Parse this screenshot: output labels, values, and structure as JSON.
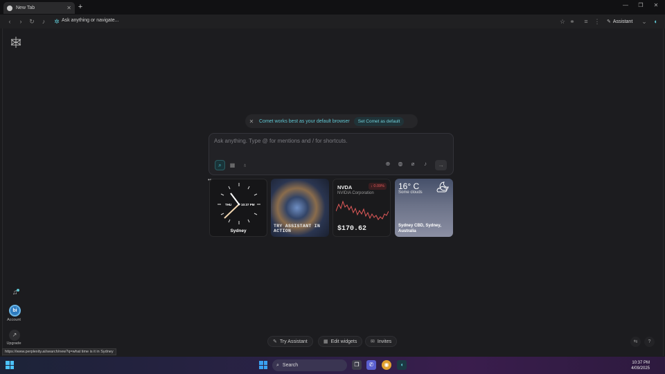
{
  "browser": {
    "tab_title": "New Tab",
    "new_tab_label": "+",
    "window_controls": {
      "minimize": "—",
      "maximize": "❐",
      "close": "✕"
    },
    "omnibox_text": "Ask anything or navigate...",
    "assistant_label": "Assistant"
  },
  "banner": {
    "text": "Comet works best as your default browser",
    "button_label": "Set Comet as default"
  },
  "search": {
    "placeholder": "Ask anything. Type @ for mentions and / for shortcuts."
  },
  "widgets": {
    "clock": {
      "city": "Sydney",
      "day": "THU",
      "time": "10:37 PM"
    },
    "image": {
      "caption": "TRY ASSISTANT IN ACTION"
    },
    "stock": {
      "ticker": "NVDA",
      "name": "NVIDIA Corporation",
      "change": "↓ 0.09%",
      "price": "$170.62",
      "trend_color": "#e25a5a"
    },
    "weather": {
      "temp": "16° C",
      "condition": "Some clouds",
      "location": "Sydney CBD, Sydney, Australia"
    }
  },
  "sidebar": {
    "account_label": "Account",
    "account_initial": "bi",
    "upgrade_label": "Upgrade"
  },
  "bottom": {
    "try_assistant": "Try Assistant",
    "edit_widgets": "Edit widgets",
    "invites": "Invites"
  },
  "status_url": "https://www.perplexity.ai/search/new?q=what time is it in Sydney",
  "taskbar": {
    "search_label": "Search",
    "time": "10:37 PM",
    "date": "4/09/2025"
  },
  "colors": {
    "accent": "#5fc7d3",
    "background": "#1c1c1f"
  }
}
